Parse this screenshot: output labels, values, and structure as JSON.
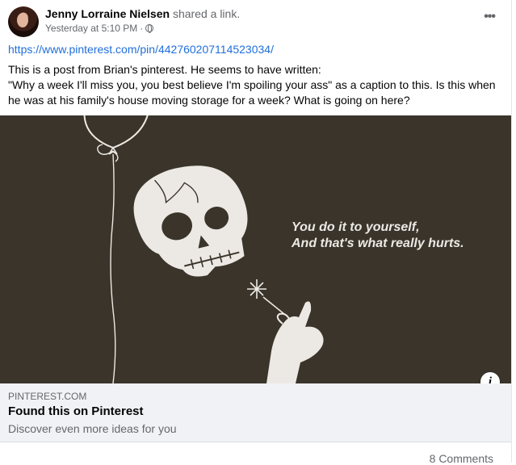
{
  "post": {
    "author": "Jenny Lorraine Nielsen",
    "action": " shared a link.",
    "timestamp": "Yesterday at 5:10 PM",
    "separator": " · ",
    "privacy_icon": "globe-icon",
    "menu_label": "•••",
    "link_url": "https://www.pinterest.com/pin/442760207114523034/",
    "text_line1": "This is a post from Brian's pinterest. He seems to have written:",
    "text_line2": "\"Why a week I'll miss you, you best believe I'm spoiling your ass\" as a caption to this. Is this when he was at his family's house moving storage for a week?  What is going on here?"
  },
  "image": {
    "caption_line1": "You do it to yourself,",
    "caption_line2": "And that's what really hurts.",
    "info_label": "i",
    "background": "#3a342b"
  },
  "preview": {
    "domain": "PINTEREST.COM",
    "title": "Found this on Pinterest",
    "description": "Discover even more ideas for you"
  },
  "footer": {
    "comments": "8 Comments"
  }
}
